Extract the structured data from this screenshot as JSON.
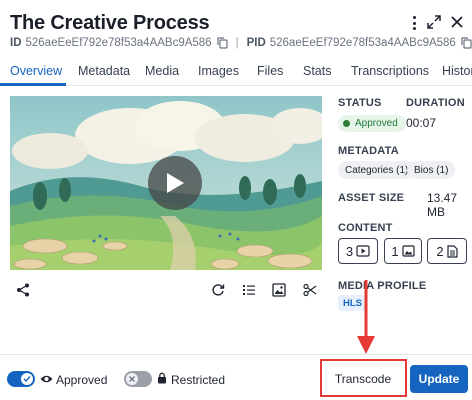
{
  "header": {
    "title": "The Creative Process",
    "id_label": "ID",
    "id_value": "526aeEeEf792e78f53a4AABc9A586",
    "pid_label": "PID",
    "pid_value": "526aeEeEf792e78f53a4AABc9A586",
    "icons": [
      "more-vert-icon",
      "expand-icon",
      "close-icon",
      "copy-icon"
    ]
  },
  "tabs": [
    {
      "label": "Overview",
      "active": true
    },
    {
      "label": "Metadata"
    },
    {
      "label": "Media"
    },
    {
      "label": "Images"
    },
    {
      "label": "Files"
    },
    {
      "label": "Stats"
    },
    {
      "label": "Transcriptions"
    },
    {
      "label": "History"
    }
  ],
  "details": {
    "status_label": "STATUS",
    "status_value": "Approved",
    "duration_label": "DURATION",
    "duration_value": "00:07",
    "metadata_label": "METADATA",
    "metadata_chips": [
      "Categories (1)",
      "Bios (1)"
    ],
    "asset_size_label": "ASSET SIZE",
    "asset_size_value": "13.47 MB",
    "content_label": "CONTENT",
    "content_counts": [
      "3",
      "1",
      "2"
    ],
    "media_profile_label": "MEDIA PROFILE",
    "media_profile_value": "HLS"
  },
  "toolbar_icons": [
    "share-icon",
    "refresh-icon",
    "list-icon",
    "image-icon",
    "scissors-icon"
  ],
  "footer": {
    "approved_label": "Approved",
    "approved_on": true,
    "restricted_label": "Restricted",
    "restricted_on": false,
    "transcode_label": "Transcode",
    "update_label": "Update"
  },
  "colors": {
    "accent": "#1565c0",
    "approved": "#2e7d32",
    "highlight": "#e53935"
  }
}
